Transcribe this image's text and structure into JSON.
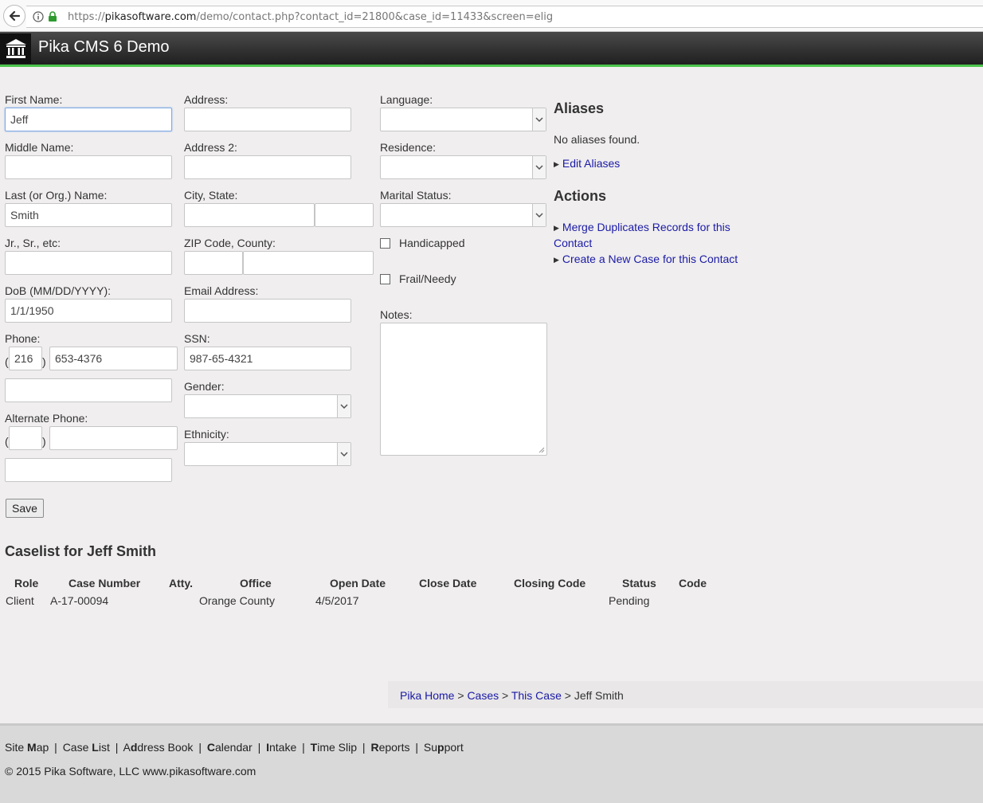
{
  "browser": {
    "url_prefix": "https://",
    "url_domain": "pikasoftware.com",
    "url_path": "/demo/contact.php?contact_id=21800&case_id=11433&screen=elig"
  },
  "app": {
    "title": "Pika CMS 6 Demo"
  },
  "form": {
    "first_name_label": "First Name:",
    "first_name_value": "Jeff",
    "middle_name_label": "Middle Name:",
    "middle_name_value": "",
    "last_name_label": "Last (or Org.) Name:",
    "last_name_value": "Smith",
    "suffix_label": "Jr., Sr., etc:",
    "suffix_value": "",
    "dob_label": "DoB (MM/DD/YYYY):",
    "dob_value": "1/1/1950",
    "phone_label": "Phone:",
    "phone_area": "216",
    "phone_number": "653-4376",
    "phone_notes": "",
    "alt_phone_label": "Alternate Phone:",
    "alt_phone_area": "",
    "alt_phone_number": "",
    "alt_phone_notes": "",
    "paren_open": "(",
    "paren_close": ")",
    "address_label": "Address:",
    "address_value": "",
    "address2_label": "Address 2:",
    "address2_value": "",
    "city_state_label": "City, State:",
    "city_value": "",
    "state_value": "",
    "zip_county_label": "ZIP Code, County:",
    "zip_value": "",
    "county_value": "",
    "email_label": "Email Address:",
    "email_value": "",
    "ssn_label": "SSN:",
    "ssn_value": "987-65-4321",
    "gender_label": "Gender:",
    "ethnicity_label": "Ethnicity:",
    "language_label": "Language:",
    "residence_label": "Residence:",
    "marital_label": "Marital Status:",
    "handicapped_label": "Handicapped",
    "handicapped_checked": false,
    "frail_label": "Frail/Needy",
    "frail_checked": false,
    "notes_label": "Notes:",
    "notes_value": "",
    "save_label": "Save"
  },
  "aliases": {
    "heading": "Aliases",
    "empty_text": "No aliases found.",
    "edit_link": "Edit Aliases"
  },
  "actions": {
    "heading": "Actions",
    "merge_link_line1": "Merge Duplicates Records for this",
    "merge_link_line2": "Contact",
    "new_case_link": "Create a New Case for this Contact"
  },
  "caselist": {
    "title": "Caselist for Jeff Smith",
    "columns": [
      "Role",
      "Case Number",
      "Atty.",
      "Office",
      "Open Date",
      "Close Date",
      "Closing Code",
      "Status",
      "Code"
    ],
    "rows": [
      {
        "role": "Client",
        "case_number": "A-17-00094",
        "atty": "",
        "office": "Orange County",
        "open_date": "4/5/2017",
        "close_date": "",
        "closing_code": "",
        "status": "Pending",
        "code": ""
      }
    ]
  },
  "breadcrumb": {
    "home": "Pika Home",
    "cases": "Cases",
    "this_case": "This Case",
    "current": "Jeff Smith",
    "separator": ">"
  },
  "footer": {
    "nav": [
      {
        "pre": "Site ",
        "key": "M",
        "post": "ap"
      },
      {
        "pre": "Case ",
        "key": "L",
        "post": "ist"
      },
      {
        "pre": "A",
        "key": "d",
        "post": "dress Book"
      },
      {
        "pre": "",
        "key": "C",
        "post": "alendar"
      },
      {
        "pre": "",
        "key": "I",
        "post": "ntake"
      },
      {
        "pre": "",
        "key": "T",
        "post": "ime Slip"
      },
      {
        "pre": "",
        "key": "R",
        "post": "eports"
      },
      {
        "pre": "Su",
        "key": "p",
        "post": "port"
      }
    ],
    "separator": "|",
    "copyright": "© 2015 Pika Software, LLC www.pikasoftware.com"
  },
  "colors": {
    "accent_green": "#4cc44c",
    "link_blue": "#1a1aa6",
    "header_dark": "#1f1f1f"
  },
  "icons": {
    "back": "back-arrow-icon",
    "info": "info-icon",
    "lock": "lock-icon",
    "logo": "courthouse-icon",
    "dropdown": "chevron-down-icon",
    "expand": "triangle-right-icon",
    "resize": "resize-grip-icon"
  }
}
